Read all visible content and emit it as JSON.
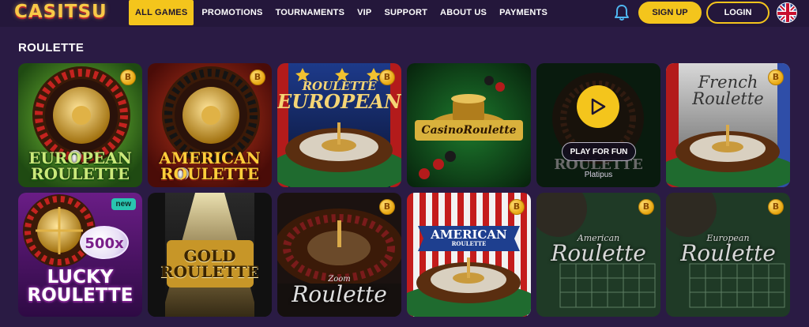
{
  "header": {
    "logo_text": "CASITSU",
    "nav": [
      {
        "label": "ALL GAMES",
        "active": true
      },
      {
        "label": "PROMOTIONS"
      },
      {
        "label": "TOURNAMENTS"
      },
      {
        "label": "VIP"
      },
      {
        "label": "SUPPORT"
      },
      {
        "label": "ABOUT US"
      },
      {
        "label": "PAYMENTS"
      }
    ],
    "signup_label": "SIGN UP",
    "login_label": "LOGIN",
    "icons": {
      "notifications": "bell-icon",
      "language": "uk-flag-icon"
    }
  },
  "section_title": "ROULETTE",
  "colors": {
    "accent": "#f4c51c",
    "background": "#2a1b44",
    "topbar": "#24173b"
  },
  "games": [
    {
      "title_lines": [
        "EUROPEAN",
        "ROULETTE"
      ],
      "coin": "B"
    },
    {
      "title_lines": [
        "AMERICAN",
        "ROULETTE"
      ],
      "coin": "B"
    },
    {
      "title_lines": [
        "ROULETTE",
        "EUROPEAN"
      ],
      "coin": "B"
    },
    {
      "title_lines": [
        "CasinoRoulette"
      ]
    },
    {
      "title_lines": [
        "ROULETTE"
      ],
      "hover_button": "PLAY FOR FUN",
      "provider": "Platipus"
    },
    {
      "title_lines": [
        "French",
        "Roulette"
      ],
      "coin": "B"
    },
    {
      "title_lines": [
        "LUCKY",
        "ROULETTE"
      ],
      "badge": "new",
      "multiplier": "500x"
    },
    {
      "title_lines": [
        "GOLD",
        "ROULETTE"
      ]
    },
    {
      "title_lines": [
        "Zoom",
        "Roulette"
      ],
      "coin": "B"
    },
    {
      "title_lines": [
        "AMERICAN",
        "ROULETTE"
      ],
      "coin": "B"
    },
    {
      "title_lines": [
        "American",
        "Roulette"
      ],
      "coin": "B"
    },
    {
      "title_lines": [
        "European",
        "Roulette"
      ],
      "coin": "B"
    }
  ]
}
